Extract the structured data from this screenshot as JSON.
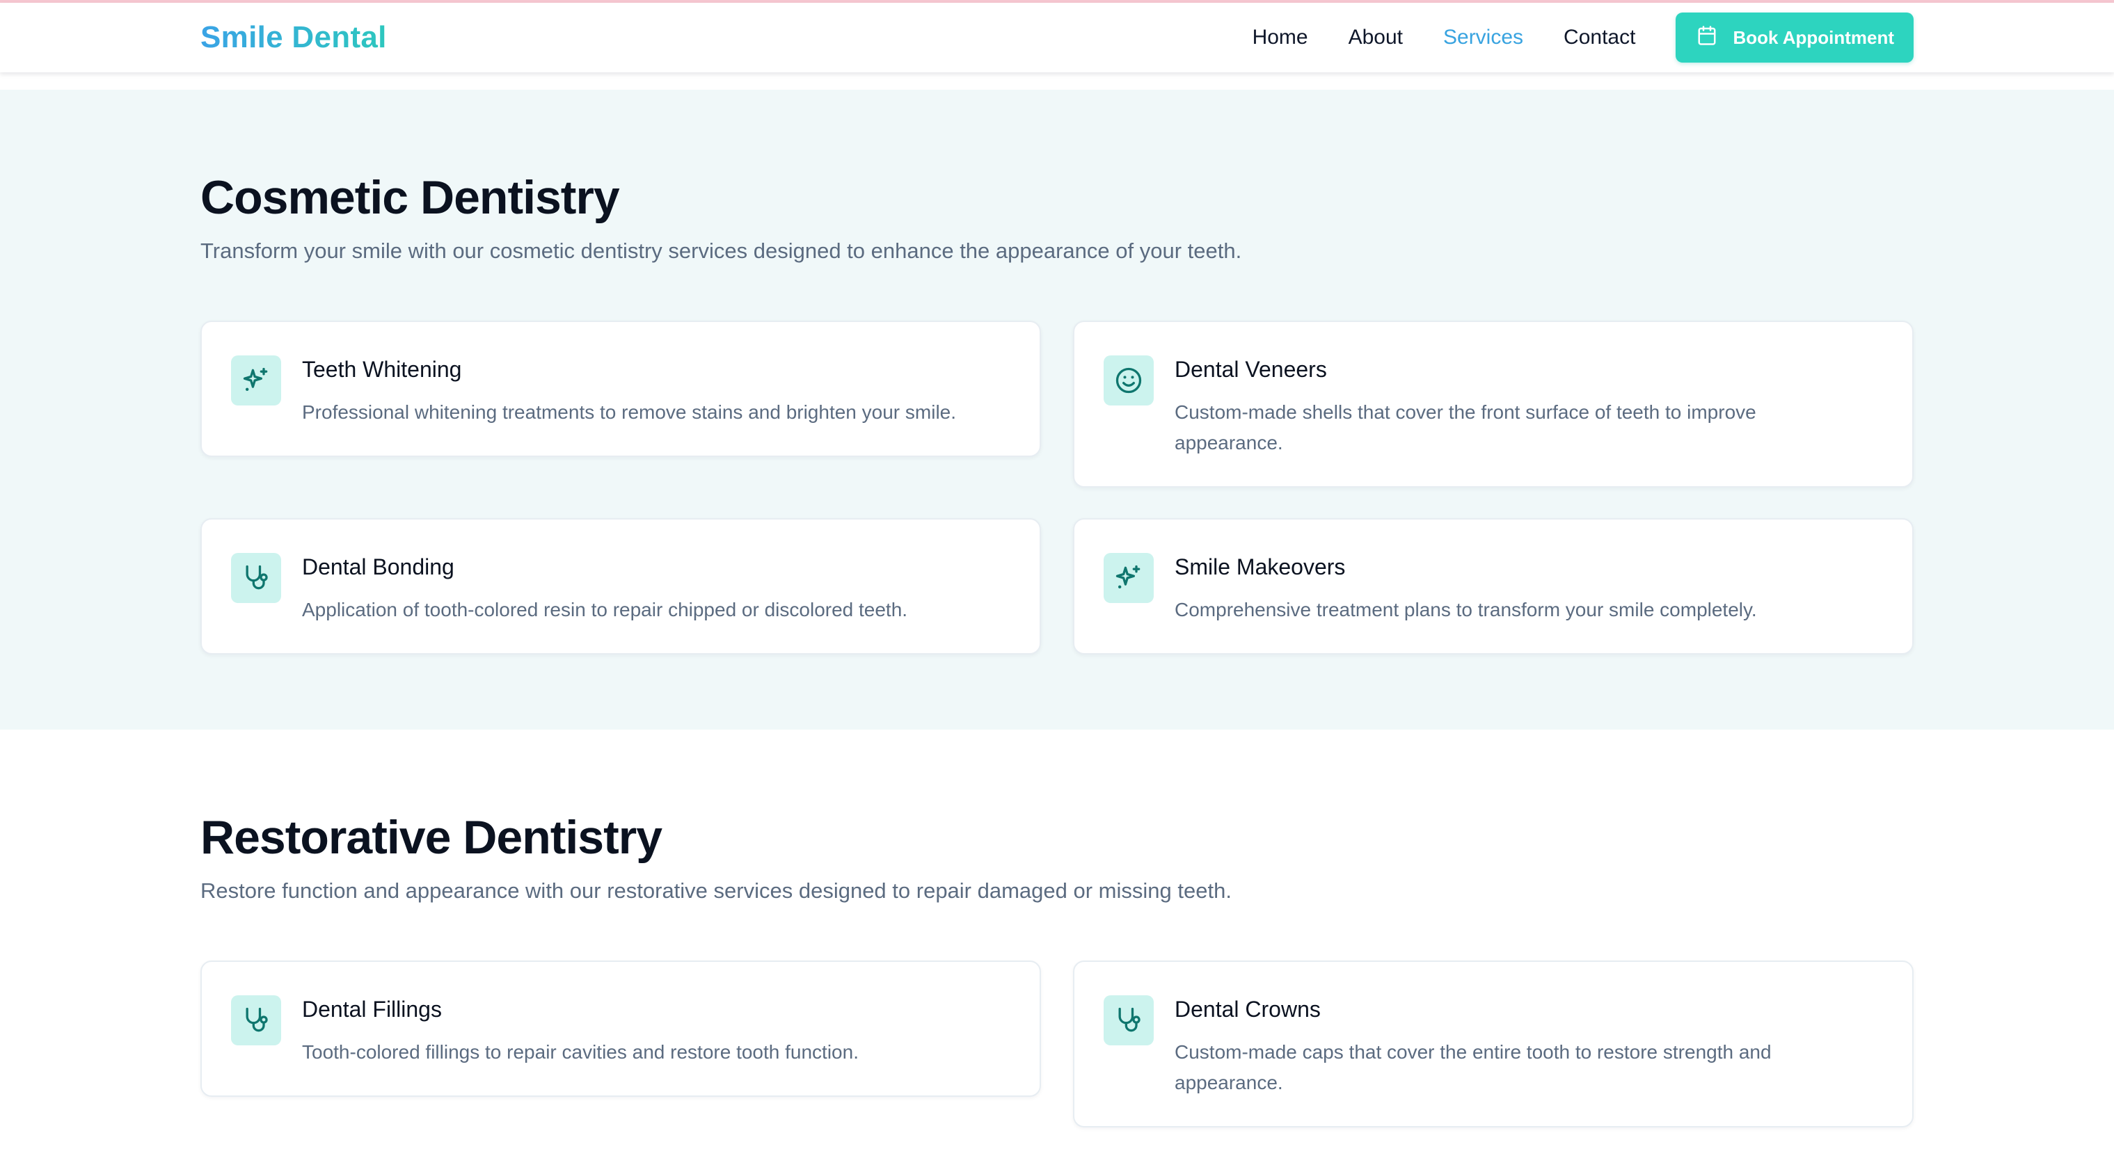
{
  "brand": {
    "name": "Smile Dental"
  },
  "nav": {
    "links": [
      {
        "label": "Home",
        "active": false
      },
      {
        "label": "About",
        "active": false
      },
      {
        "label": "Services",
        "active": true
      },
      {
        "label": "Contact",
        "active": false
      }
    ],
    "cta_label": "Book Appointment"
  },
  "colors": {
    "accent": "#2dd4bf",
    "brand_gradient_start": "#3aa3e6",
    "brand_gradient_end": "#2dc7be",
    "active_link": "#38a3e0",
    "icon_color": "#0f766e",
    "icon_bg": "#ccf3ee"
  },
  "cosmetic": {
    "title": "Cosmetic Dentistry",
    "subtitle": "Transform your smile with our cosmetic dentistry services designed to enhance the appearance of your teeth.",
    "cards": [
      {
        "icon": "sparkles-icon",
        "title": "Teeth Whitening",
        "desc": "Professional whitening treatments to remove stains and brighten your smile."
      },
      {
        "icon": "smile-icon",
        "title": "Dental Veneers",
        "desc": "Custom-made shells that cover the front surface of teeth to improve appearance."
      },
      {
        "icon": "stethoscope-icon",
        "title": "Dental Bonding",
        "desc": "Application of tooth-colored resin to repair chipped or discolored teeth."
      },
      {
        "icon": "sparkles-icon",
        "title": "Smile Makeovers",
        "desc": "Comprehensive treatment plans to transform your smile completely."
      }
    ]
  },
  "restorative": {
    "title": "Restorative Dentistry",
    "subtitle": "Restore function and appearance with our restorative services designed to repair damaged or missing teeth.",
    "cards": [
      {
        "icon": "stethoscope-icon",
        "title": "Dental Fillings",
        "desc": "Tooth-colored fillings to repair cavities and restore tooth function."
      },
      {
        "icon": "stethoscope-icon",
        "title": "Dental Crowns",
        "desc": "Custom-made caps that cover the entire tooth to restore strength and appearance."
      }
    ]
  }
}
